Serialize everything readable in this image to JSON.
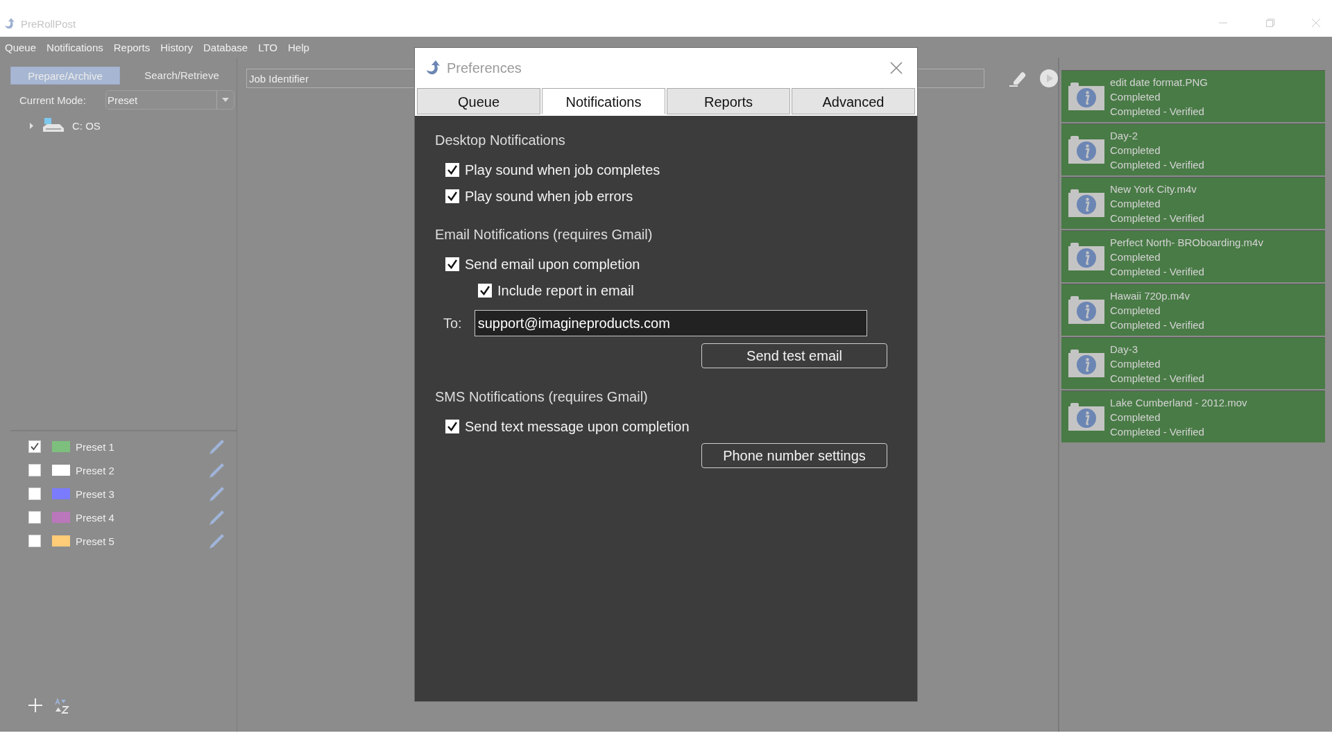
{
  "window": {
    "title": "PreRollPost"
  },
  "menu": [
    "Queue",
    "Notifications",
    "Reports",
    "History",
    "Database",
    "LTO",
    "Help"
  ],
  "mode_tabs": [
    {
      "label": "Prepare/Archive",
      "selected": true
    },
    {
      "label": "Search/Retrieve",
      "selected": false
    }
  ],
  "current_mode": {
    "label": "Current Mode:",
    "value": "Preset"
  },
  "tree": [
    {
      "label": "C: OS",
      "expanded": false
    }
  ],
  "presets": [
    {
      "name": "Preset 1",
      "checked": true,
      "color": "#7dbf7d"
    },
    {
      "name": "Preset 2",
      "checked": false,
      "color": "#ffffff"
    },
    {
      "name": "Preset 3",
      "checked": false,
      "color": "#7b7bff"
    },
    {
      "name": "Preset 4",
      "checked": false,
      "color": "#bb77bb"
    },
    {
      "name": "Preset 5",
      "checked": false,
      "color": "#ffcc77"
    }
  ],
  "job_field": {
    "placeholder": "Job Identifier"
  },
  "jobs": [
    {
      "name": "edit date format.PNG",
      "status": "Completed",
      "verification": "Completed - Verified"
    },
    {
      "name": "Day-2",
      "status": "Completed",
      "verification": "Completed - Verified"
    },
    {
      "name": "New York City.m4v",
      "status": "Completed",
      "verification": "Completed - Verified"
    },
    {
      "name": "Perfect North- BROboarding.m4v",
      "status": "Completed",
      "verification": "Completed - Verified"
    },
    {
      "name": "Hawaii 720p.m4v",
      "status": "Completed",
      "verification": "Completed - Verified"
    },
    {
      "name": "Day-3",
      "status": "Completed",
      "verification": "Completed - Verified"
    },
    {
      "name": "Lake Cumberland - 2012.mov",
      "status": "Completed",
      "verification": "Completed - Verified"
    }
  ],
  "dialog": {
    "title": "Preferences",
    "tabs": [
      {
        "label": "Queue",
        "selected": false
      },
      {
        "label": "Notifications",
        "selected": true
      },
      {
        "label": "Reports",
        "selected": false
      },
      {
        "label": "Advanced",
        "selected": false
      }
    ],
    "sections": [
      {
        "heading": "Desktop Notifications",
        "options": [
          {
            "label": "Play sound when job completes",
            "checked": true
          },
          {
            "label": "Play sound when job errors",
            "checked": true
          }
        ]
      },
      {
        "heading": "Email Notifications (requires Gmail)",
        "options": [
          {
            "label": "Send email upon completion",
            "checked": true,
            "children": [
              {
                "label": "Include report in email",
                "checked": true
              }
            ]
          }
        ],
        "email": {
          "label": "To:",
          "value": "support@imagineproducts.com"
        },
        "button": "Send test email"
      },
      {
        "heading": "SMS Notifications (requires Gmail)",
        "options": [
          {
            "label": "Send text message upon completion",
            "checked": true
          }
        ],
        "button": "Phone number settings"
      }
    ]
  }
}
